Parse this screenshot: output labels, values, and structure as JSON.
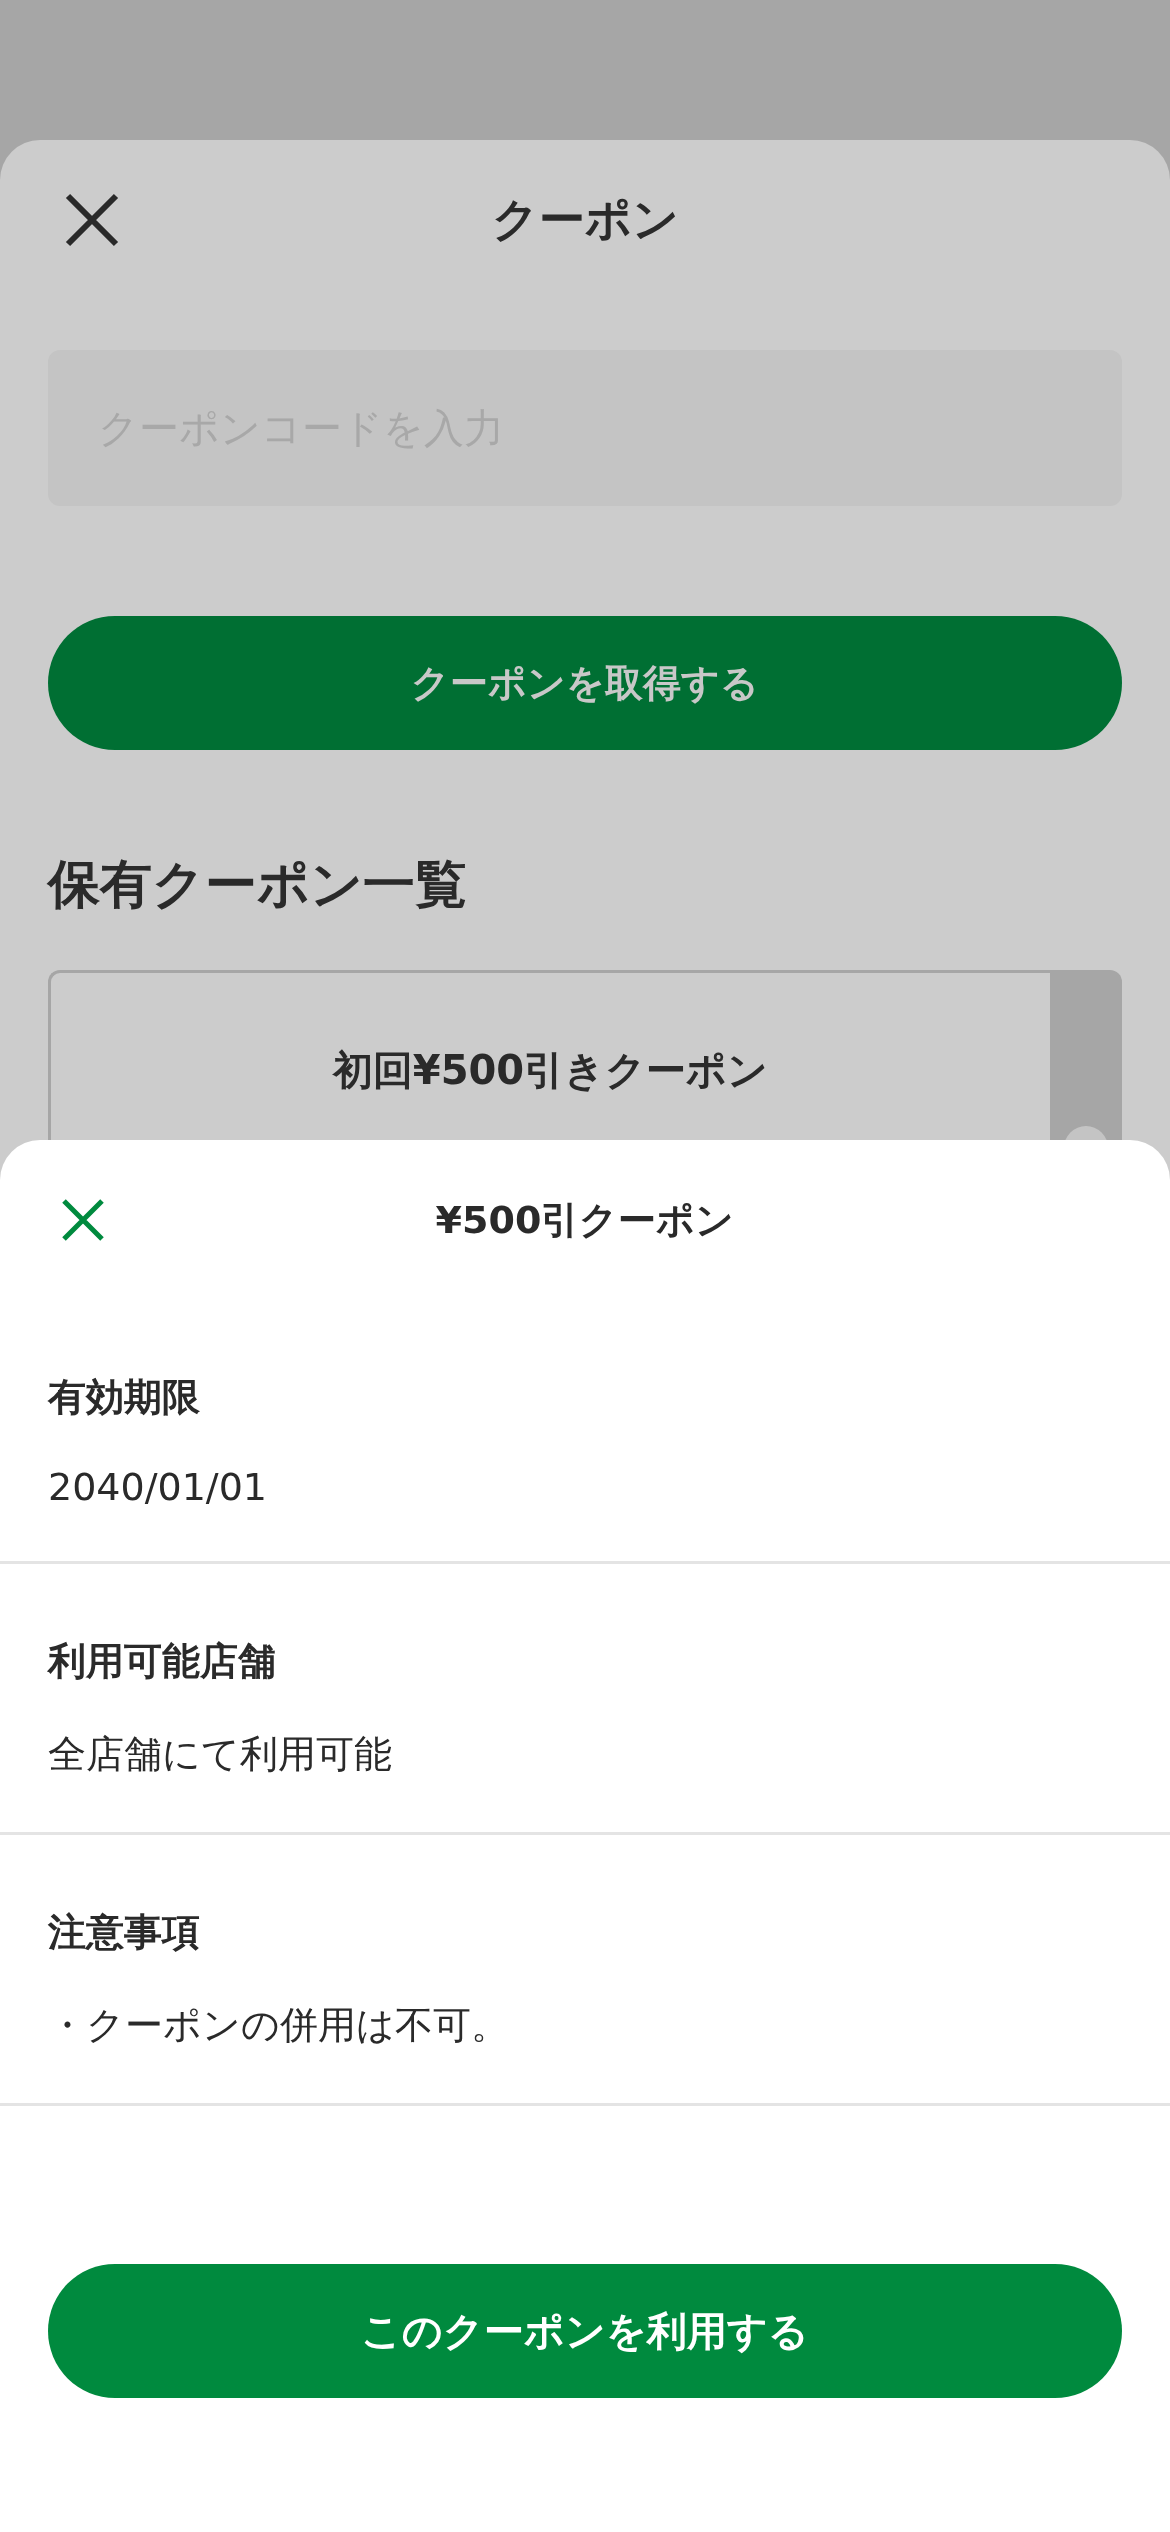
{
  "background_screen": {
    "title": "クーポン",
    "code_field": {
      "placeholder": "クーポンコードを入力"
    },
    "get_button": "クーポンを取得する",
    "section_title": "保有クーポン一覧",
    "coupon_card": {
      "name": "初回¥500引きクーポン"
    }
  },
  "detail_sheet": {
    "title": "¥500引クーポン",
    "sections": [
      {
        "label": "有効期限",
        "value": "2040/01/01"
      },
      {
        "label": "利用可能店舗",
        "value": "全店舗にて利用可能"
      },
      {
        "label": "注意事項",
        "value": "・クーポンの併用は不可。"
      }
    ],
    "use_button": "このクーポンを利用する"
  }
}
